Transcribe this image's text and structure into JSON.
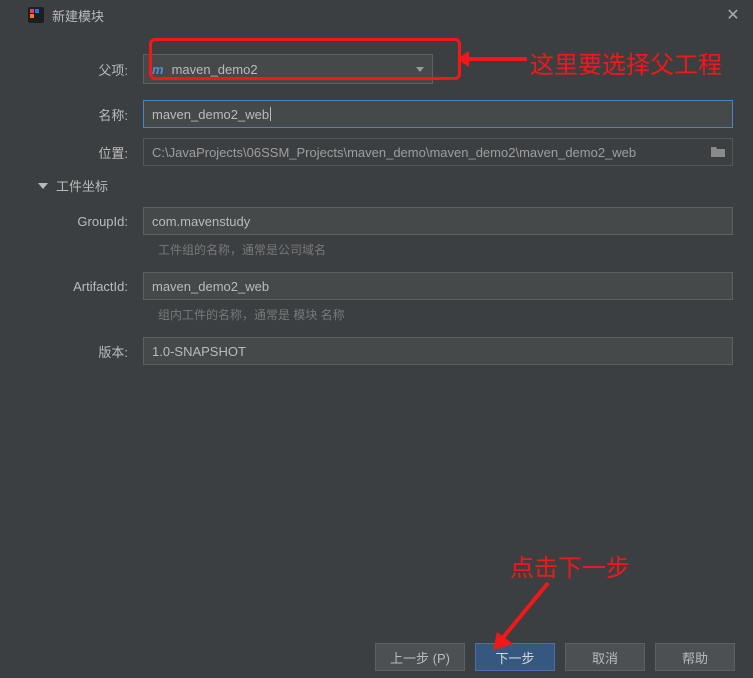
{
  "title": "新建模块",
  "labels": {
    "parent": "父项:",
    "name": "名称:",
    "location": "位置:",
    "coords_section": "工件坐标",
    "groupid": "GroupId:",
    "artifactid": "ArtifactId:",
    "version": "版本:"
  },
  "values": {
    "parent": "maven_demo2",
    "name": "maven_demo2_web",
    "location": "C:\\JavaProjects\\06SSM_Projects\\maven_demo\\maven_demo2\\maven_demo2_web",
    "groupid": "com.mavenstudy",
    "artifactid": "maven_demo2_web",
    "version": "1.0-SNAPSHOT"
  },
  "hints": {
    "groupid": "工件组的名称，通常是公司域名",
    "artifactid": "组内工件的名称，通常是 模块 名称"
  },
  "buttons": {
    "prev": "上一步 (P)",
    "next": "下一步",
    "cancel": "取消",
    "help": "帮助"
  },
  "annotations": {
    "a1": "这里要选择父工程",
    "a2": "点击下一步"
  }
}
